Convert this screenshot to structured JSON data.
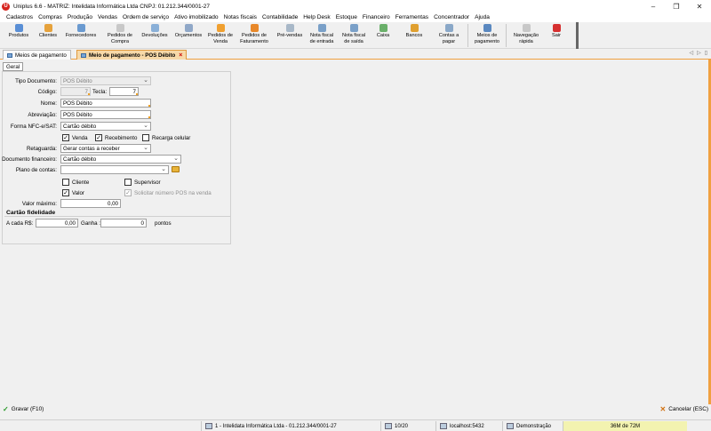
{
  "window": {
    "title": "Uniplus 6.6 - MATRIZ: Intelidata Informática Ltda CNPJ: 01.212.344/0001-27",
    "logo": "U"
  },
  "menu": [
    "Cadastros",
    "Compras",
    "Produção",
    "Vendas",
    "Ordem de serviço",
    "Ativo imobilizado",
    "Notas fiscais",
    "Contabilidade",
    "Help Desk",
    "Estoque",
    "Financeiro",
    "Ferramentas",
    "Concentrador",
    "Ajuda"
  ],
  "toolbar": [
    {
      "label": "Produtos",
      "icon": "box-icon",
      "color": "#5a8fd6"
    },
    {
      "label": "Clientes",
      "icon": "person-icon",
      "color": "#e6a23c"
    },
    {
      "label": "Fornecedores",
      "icon": "people-icon",
      "color": "#6a9ad0"
    },
    {
      "label": "Pedidos de\nCompra",
      "icon": "cart-icon",
      "color": "#c8c8c8"
    },
    {
      "label": "Devoluções",
      "icon": "return-icon",
      "color": "#8ab0d8"
    },
    {
      "label": "Orçamentos",
      "icon": "document-icon",
      "color": "#90a8c8"
    },
    {
      "label": "Pedidos de\nVenda",
      "icon": "sales-icon",
      "color": "#f0a030"
    },
    {
      "label": "Pedidos de\nFaturamento",
      "icon": "billing-icon",
      "color": "#e8882a"
    },
    {
      "label": "Pré-vendas",
      "icon": "presale-icon",
      "color": "#a8b8c8"
    },
    {
      "label": "Nota fiscal\nde entrada",
      "icon": "invoice-in-icon",
      "color": "#7aa0c8"
    },
    {
      "label": "Nota fiscal\nde saída",
      "icon": "invoice-out-icon",
      "color": "#7aa0c8"
    },
    {
      "label": "Caixa",
      "icon": "cashier-icon",
      "color": "#6ab06a"
    },
    {
      "label": "Bancos",
      "icon": "bank-icon",
      "color": "#e0a030"
    },
    {
      "label": "Contas a\npagar",
      "icon": "payable-icon",
      "color": "#8aa8c8"
    },
    {
      "label": "Meios de\npagamento",
      "icon": "payment-icon",
      "color": "#5a88c0"
    },
    {
      "label": "Navegação\nrápida",
      "icon": "navigation-icon",
      "color": "#c8c8c8"
    },
    {
      "label": "Sair",
      "icon": "exit-icon",
      "color": "#d63030"
    }
  ],
  "tabs": [
    {
      "label": "Meios de pagamento",
      "active": false
    },
    {
      "label": "Meio de pagamento - POS Débito",
      "active": true
    }
  ],
  "form": {
    "subtab": "Geral",
    "tipo_documento_label": "Tipo Documento:",
    "tipo_documento_value": "POS Débito",
    "codigo_label": "Código:",
    "codigo_value": "7",
    "tecla_label": "Tecla:",
    "tecla_value": "7",
    "nome_label": "Nome:",
    "nome_value": "POS Débito",
    "abreviacao_label": "Abreviação:",
    "abreviacao_value": "POS Débito",
    "forma_label": "Forma NFC-e/SAT:",
    "forma_value": "Cartão débito",
    "venda_label": "Venda",
    "recebimento_label": "Recebimento",
    "recarga_label": "Recarga celular",
    "retaguarda_label": "Retaguarda:",
    "retaguarda_value": "Gerar contas a receber",
    "doc_fin_label": "Documento financeiro:",
    "doc_fin_value": "Cartão débito",
    "plano_label": "Plano de contas:",
    "plano_value": "",
    "cliente_label": "Cliente",
    "supervisor_label": "Supervisor",
    "valor_label": "Valor",
    "solicitar_pos_label": "Solicitar número POS na venda",
    "valor_maximo_label": "Valor máximo:",
    "valor_maximo_value": "0,00",
    "fidelidade_title": "Cartão fidelidade",
    "a_cada_label": "A cada R$:",
    "a_cada_value": "0,00",
    "ganha_label": "Ganha :",
    "ganha_value": "0",
    "pontos_label": "pontos"
  },
  "actions": {
    "save": "Gravar (F10)",
    "cancel": "Cancelar (ESC)"
  },
  "status": {
    "company": "1 - Intelidata Informática Ltda - 01.212.344/0001-27",
    "pages": "10/20",
    "server": "localhost:5432",
    "mode": "Demonstração",
    "memory": "36M de 72M"
  }
}
